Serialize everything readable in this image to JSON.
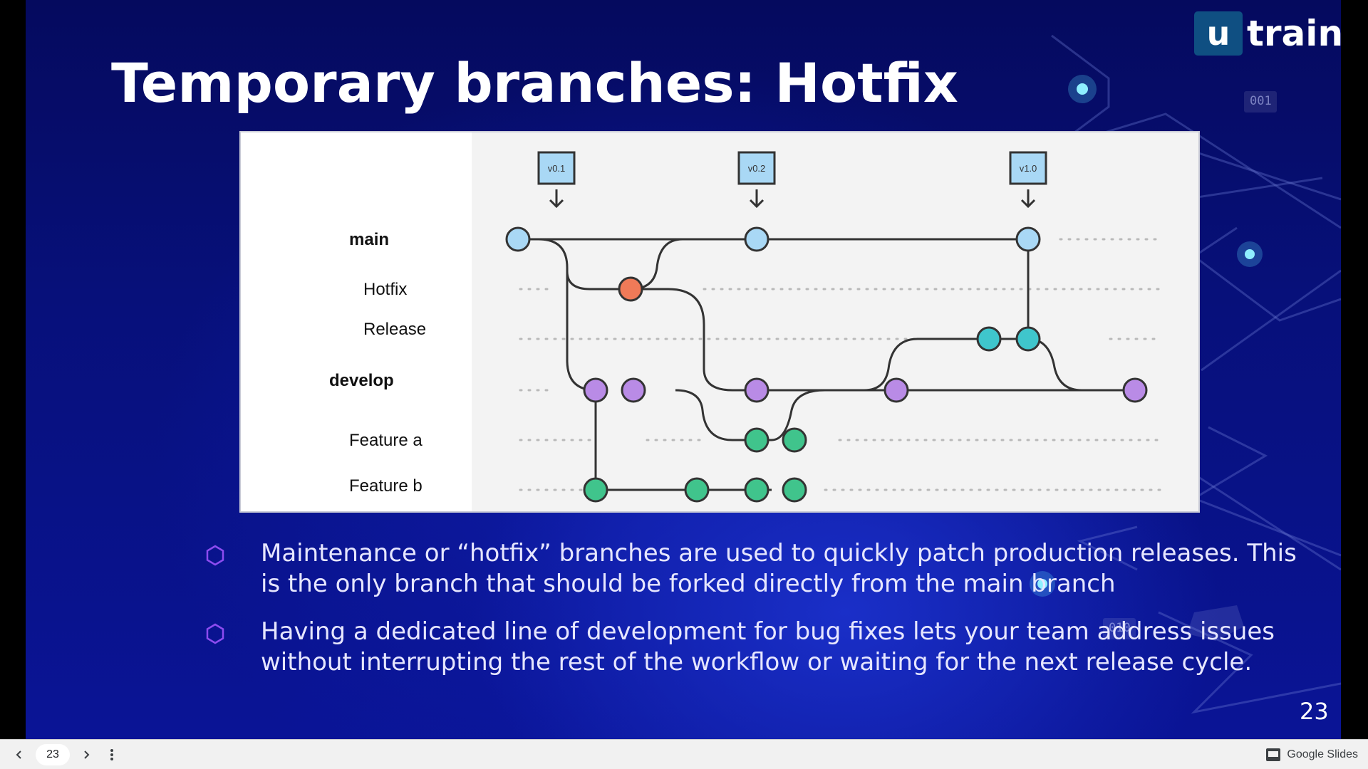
{
  "slide": {
    "title": "Temporary branches: Hotfix",
    "logo": {
      "box_letter": "u",
      "text": "train"
    },
    "slide_number": "23",
    "deco_codes": [
      "001",
      "010"
    ],
    "colors": {
      "background": "#0a1496",
      "bullet_icon": "#8d4cf0",
      "text": "#e6e6ff"
    },
    "bullets": [
      "Maintenance or “hotfix” branches are used to quickly patch production releases. This is the only branch that should be forked directly from the main branch",
      "Having a dedicated line of development for bug fixes lets your team address issues without interrupting the rest of the workflow or waiting for the next release cycle."
    ]
  },
  "diagram": {
    "branch_labels": {
      "main": "main",
      "hotfix": "Hotfix",
      "release": "Release",
      "develop": "develop",
      "feature_a": "Feature a",
      "feature_b": "Feature b"
    },
    "tags": [
      "v0.1",
      "v0.2",
      "v1.0"
    ],
    "colors": {
      "main_node": "#a9d8f5",
      "hotfix_node": "#f07a58",
      "release_node": "#3fc6cc",
      "develop_node": "#b98be6",
      "feature_node": "#40c48c",
      "line": "#333333"
    }
  },
  "toolbar": {
    "prev_icon": "chevron-left-icon",
    "page_number": "23",
    "next_icon": "chevron-right-icon",
    "more_icon": "more-vertical-icon",
    "brand_icon": "slides-icon",
    "brand_label": "Google Slides"
  }
}
